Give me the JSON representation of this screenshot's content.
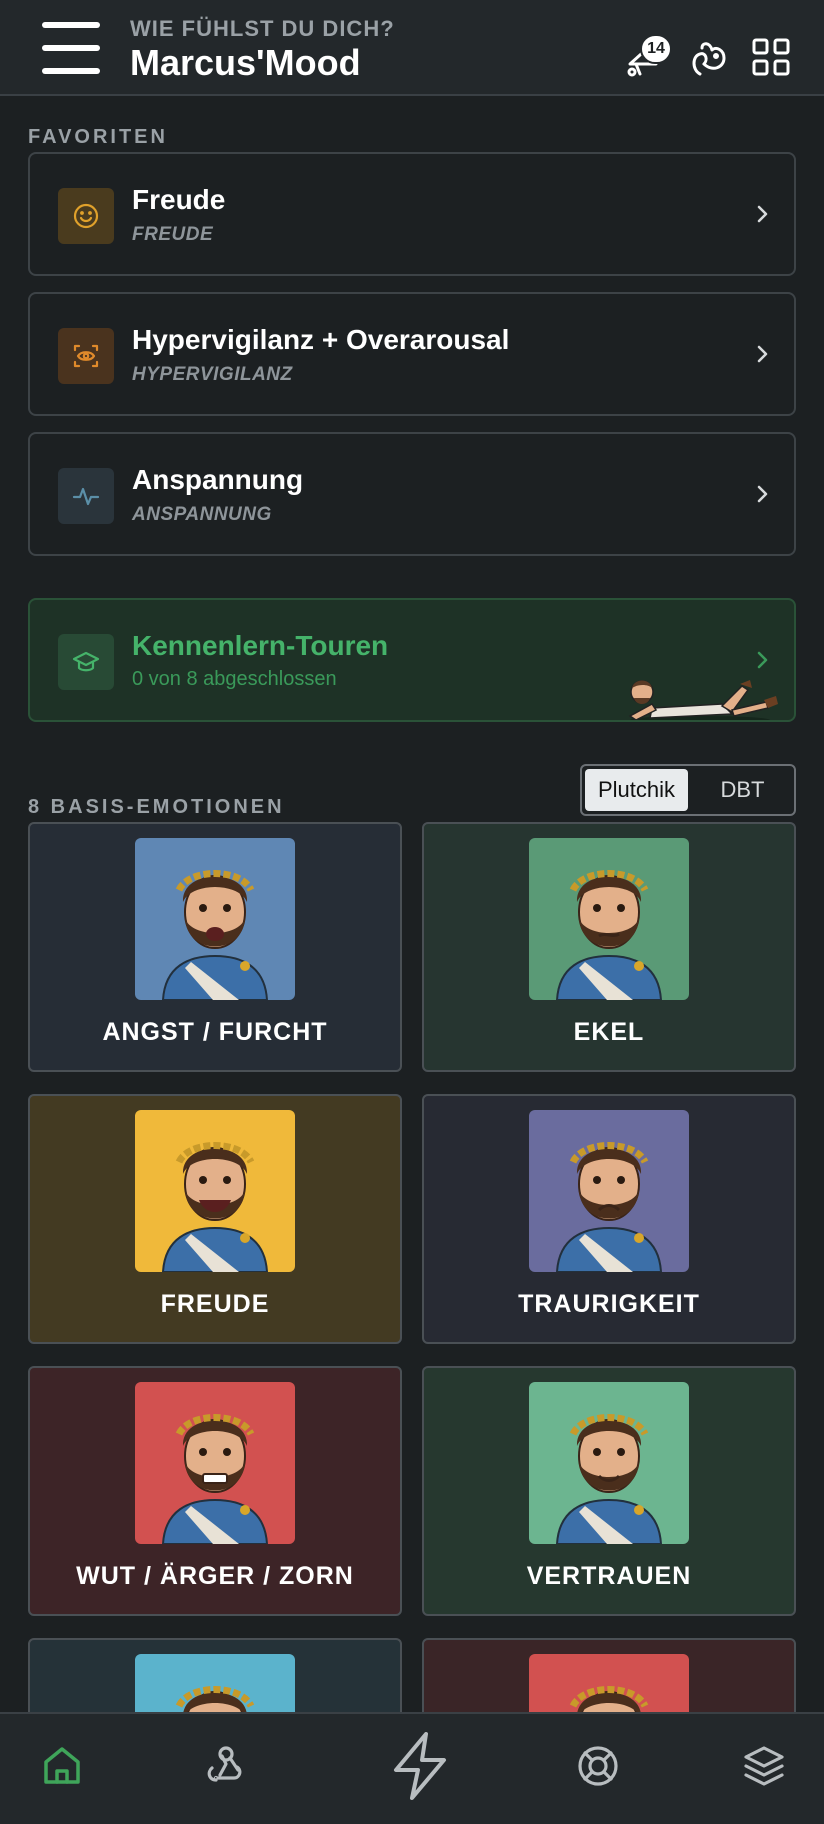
{
  "header": {
    "subtitle": "WIE FÜHLST DU DICH?",
    "title": "Marcus'Mood",
    "notification_count": "14"
  },
  "favorites": {
    "label": "FAVORITEN",
    "items": [
      {
        "title": "Freude",
        "subtitle": "FREUDE",
        "icon": "smile-icon",
        "accent": "#e0a12b"
      },
      {
        "title": "Hypervigilanz + Overarousal",
        "subtitle": "HYPERVIGILANZ",
        "icon": "eye-scan-icon",
        "accent": "#e08a2b"
      },
      {
        "title": "Anspannung",
        "subtitle": "ANSPANNUNG",
        "icon": "pulse-icon",
        "accent": "#5b8fa8"
      }
    ]
  },
  "tour": {
    "title": "Kennenlern-Touren",
    "subtitle": "0 von 8 abgeschlossen",
    "accent": "#45b36a"
  },
  "emotions": {
    "label": "8 BASIS-EMOTIONEN",
    "toggle": {
      "option_a": "Plutchik",
      "option_b": "DBT",
      "active": "Plutchik"
    },
    "items": [
      {
        "label": "ANGST / FURCHT",
        "card_bg": "#262d36",
        "portrait_bg": "#5f87b4",
        "mood": "fear"
      },
      {
        "label": "EKEL",
        "card_bg": "#263530",
        "portrait_bg": "#5a9a76",
        "mood": "disgust"
      },
      {
        "label": "FREUDE",
        "card_bg": "#433a22",
        "portrait_bg": "#f0b93a",
        "mood": "joy"
      },
      {
        "label": "TRAURIGKEIT",
        "card_bg": "#272a33",
        "portrait_bg": "#6a6c9e",
        "mood": "sadness"
      },
      {
        "label": "WUT / ÄRGER / ZORN",
        "card_bg": "#3d2427",
        "portrait_bg": "#d25150",
        "mood": "anger"
      },
      {
        "label": "VERTRAUEN",
        "card_bg": "#26382f",
        "portrait_bg": "#6cb590",
        "mood": "trust"
      },
      {
        "label": "",
        "card_bg": "#253238",
        "portrait_bg": "#5bb3cc",
        "mood": "surprise"
      },
      {
        "label": "",
        "card_bg": "#3a2527",
        "portrait_bg": "#d25150",
        "mood": "anticipation"
      }
    ]
  },
  "nav": {
    "items": [
      "home-icon",
      "webhook-icon",
      "lightning-icon",
      "lifebuoy-icon",
      "layers-icon"
    ],
    "active_color": "#3fa55a",
    "inactive_color": "#b8bdc0"
  }
}
